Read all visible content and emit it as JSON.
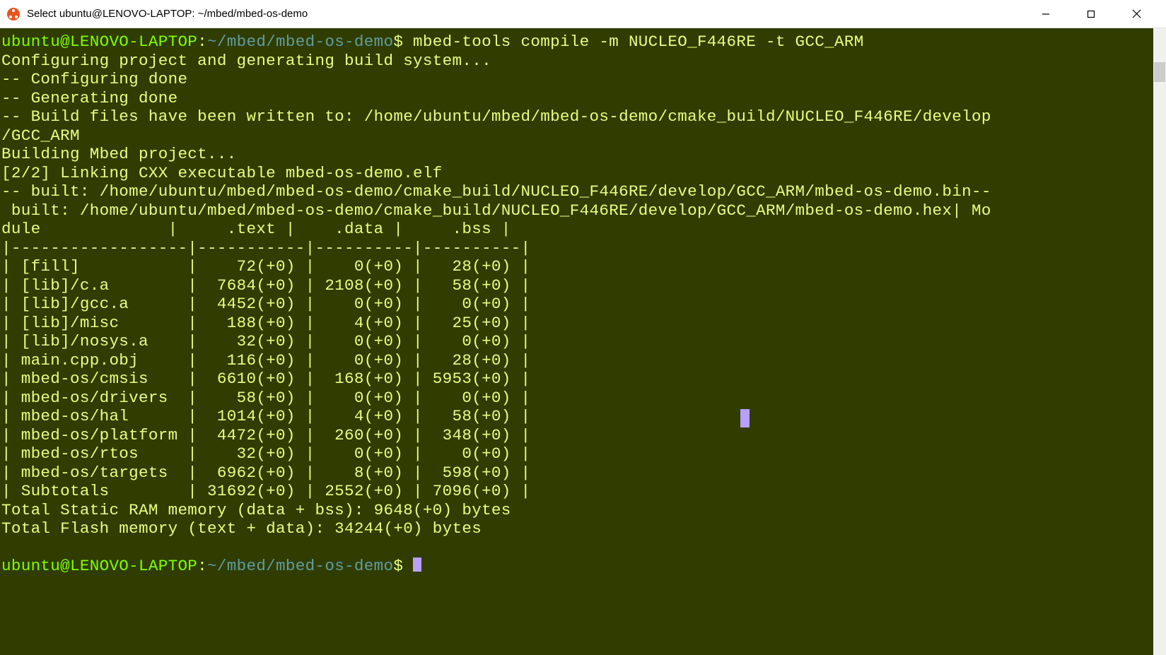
{
  "titlebar": {
    "title": "Select ubuntu@LENOVO-LAPTOP: ~/mbed/mbed-os-demo"
  },
  "prompt": {
    "user_host": "ubuntu@LENOVO-LAPTOP",
    "colon": ":",
    "path": "~/mbed/mbed-os-demo",
    "dollar": "$",
    "command": " mbed-tools compile -m NUCLEO_F446RE -t GCC_ARM"
  },
  "output_lines": [
    "Configuring project and generating build system...",
    "-- Configuring done",
    "-- Generating done",
    "-- Build files have been written to: /home/ubuntu/mbed/mbed-os-demo/cmake_build/NUCLEO_F446RE/develop",
    "/GCC_ARM",
    "Building Mbed project...",
    "[2/2] Linking CXX executable mbed-os-demo.elf",
    "-- built: /home/ubuntu/mbed/mbed-os-demo/cmake_build/NUCLEO_F446RE/develop/GCC_ARM/mbed-os-demo.bin--",
    " built: /home/ubuntu/mbed/mbed-os-demo/cmake_build/NUCLEO_F446RE/develop/GCC_ARM/mbed-os-demo.hex| Mo",
    "dule             |     .text |    .data |     .bss |",
    "|------------------|-----------|----------|----------|",
    "| [fill]           |    72(+0) |    0(+0) |   28(+0) |",
    "| [lib]/c.a        |  7684(+0) | 2108(+0) |   58(+0) |",
    "| [lib]/gcc.a      |  4452(+0) |    0(+0) |    0(+0) |",
    "| [lib]/misc       |   188(+0) |    4(+0) |   25(+0) |",
    "| [lib]/nosys.a    |    32(+0) |    0(+0) |    0(+0) |",
    "| main.cpp.obj     |   116(+0) |    0(+0) |   28(+0) |",
    "| mbed-os/cmsis    |  6610(+0) |  168(+0) | 5953(+0) |",
    "| mbed-os/drivers  |    58(+0) |    0(+0) |    0(+0) |",
    "| mbed-os/hal      |  1014(+0) |    4(+0) |   58(+0) |",
    "| mbed-os/platform |  4472(+0) |  260(+0) |  348(+0) |",
    "| mbed-os/rtos     |    32(+0) |    0(+0) |    0(+0) |",
    "| mbed-os/targets  |  6962(+0) |    8(+0) |  598(+0) |",
    "| Subtotals        | 31692(+0) | 2552(+0) | 7096(+0) |",
    "Total Static RAM memory (data + bss): 9648(+0) bytes",
    "Total Flash memory (text + data): 34244(+0) bytes",
    ""
  ],
  "prompt2": {
    "user_host": "ubuntu@LENOVO-LAPTOP",
    "colon": ":",
    "path": "~/mbed/mbed-os-demo",
    "dollar": "$"
  },
  "build_table": {
    "columns": [
      "Module",
      ".text",
      ".data",
      ".bss"
    ],
    "rows": [
      {
        "module": "[fill]",
        "text": "72(+0)",
        "data": "0(+0)",
        "bss": "28(+0)"
      },
      {
        "module": "[lib]/c.a",
        "text": "7684(+0)",
        "data": "2108(+0)",
        "bss": "58(+0)"
      },
      {
        "module": "[lib]/gcc.a",
        "text": "4452(+0)",
        "data": "0(+0)",
        "bss": "0(+0)"
      },
      {
        "module": "[lib]/misc",
        "text": "188(+0)",
        "data": "4(+0)",
        "bss": "25(+0)"
      },
      {
        "module": "[lib]/nosys.a",
        "text": "32(+0)",
        "data": "0(+0)",
        "bss": "0(+0)"
      },
      {
        "module": "main.cpp.obj",
        "text": "116(+0)",
        "data": "0(+0)",
        "bss": "28(+0)"
      },
      {
        "module": "mbed-os/cmsis",
        "text": "6610(+0)",
        "data": "168(+0)",
        "bss": "5953(+0)"
      },
      {
        "module": "mbed-os/drivers",
        "text": "58(+0)",
        "data": "0(+0)",
        "bss": "0(+0)"
      },
      {
        "module": "mbed-os/hal",
        "text": "1014(+0)",
        "data": "4(+0)",
        "bss": "58(+0)"
      },
      {
        "module": "mbed-os/platform",
        "text": "4472(+0)",
        "data": "260(+0)",
        "bss": "348(+0)"
      },
      {
        "module": "mbed-os/rtos",
        "text": "32(+0)",
        "data": "0(+0)",
        "bss": "0(+0)"
      },
      {
        "module": "mbed-os/targets",
        "text": "6962(+0)",
        "data": "8(+0)",
        "bss": "598(+0)"
      },
      {
        "module": "Subtotals",
        "text": "31692(+0)",
        "data": "2552(+0)",
        "bss": "7096(+0)"
      }
    ],
    "total_ram": "Total Static RAM memory (data + bss): 9648(+0) bytes",
    "total_flash": "Total Flash memory (text + data): 34244(+0) bytes"
  }
}
